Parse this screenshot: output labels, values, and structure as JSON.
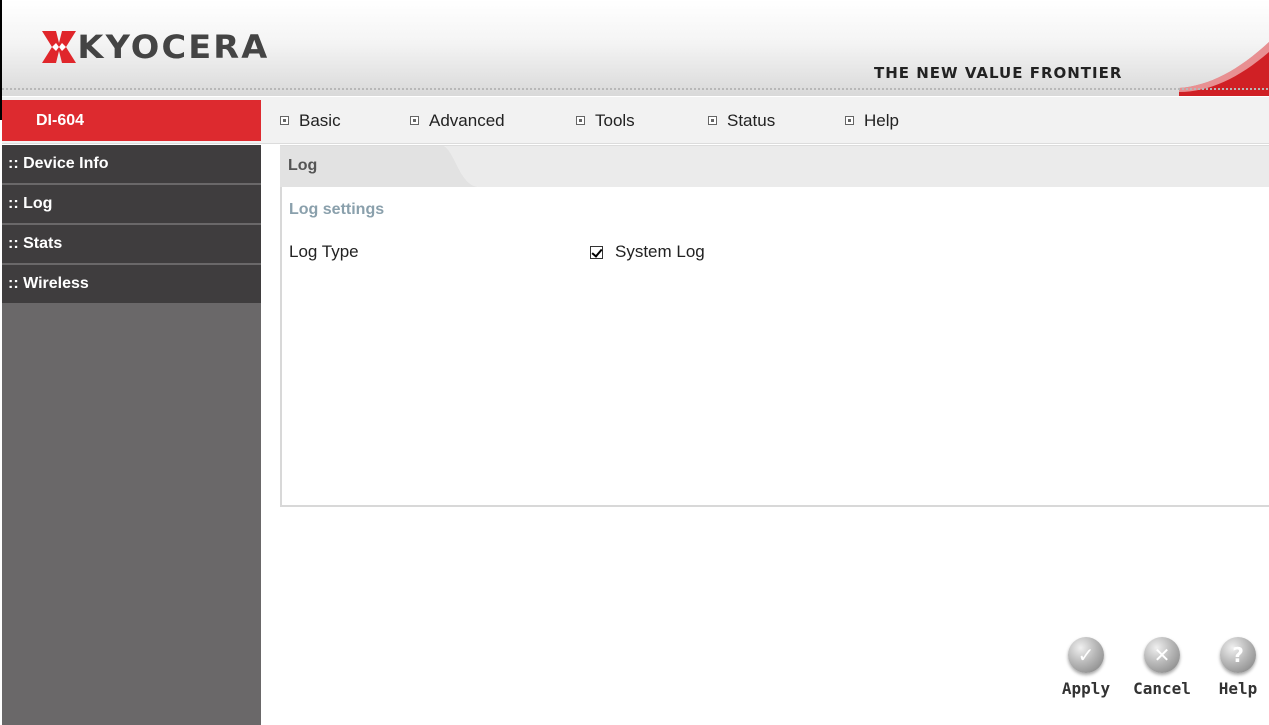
{
  "header": {
    "brand": "KYOCERA",
    "tagline": "THE NEW VALUE FRONTIER"
  },
  "navbar": {
    "model": "DI-604",
    "menu": [
      {
        "label": "Basic"
      },
      {
        "label": "Advanced"
      },
      {
        "label": "Tools"
      },
      {
        "label": "Status"
      },
      {
        "label": "Help"
      }
    ]
  },
  "sidebar": {
    "items": [
      {
        "label": ":: Device Info"
      },
      {
        "label": ":: Log"
      },
      {
        "label": ":: Stats"
      },
      {
        "label": ":: Wireless"
      }
    ]
  },
  "panel": {
    "title": "Log",
    "section_heading": "Log settings",
    "field_label": "Log Type",
    "checkbox_label": "System Log",
    "checkbox_checked": true
  },
  "actions": {
    "apply": {
      "label": "Apply",
      "icon": "✓"
    },
    "cancel": {
      "label": "Cancel",
      "icon": "✕"
    },
    "help": {
      "label": "Help",
      "icon": "?"
    }
  },
  "colors": {
    "accent_red": "#dd2a2f",
    "sidebar_dark": "#3f3d3e",
    "sidebar_bg": "#6a6869",
    "section_heading": "#8aa0ac"
  }
}
